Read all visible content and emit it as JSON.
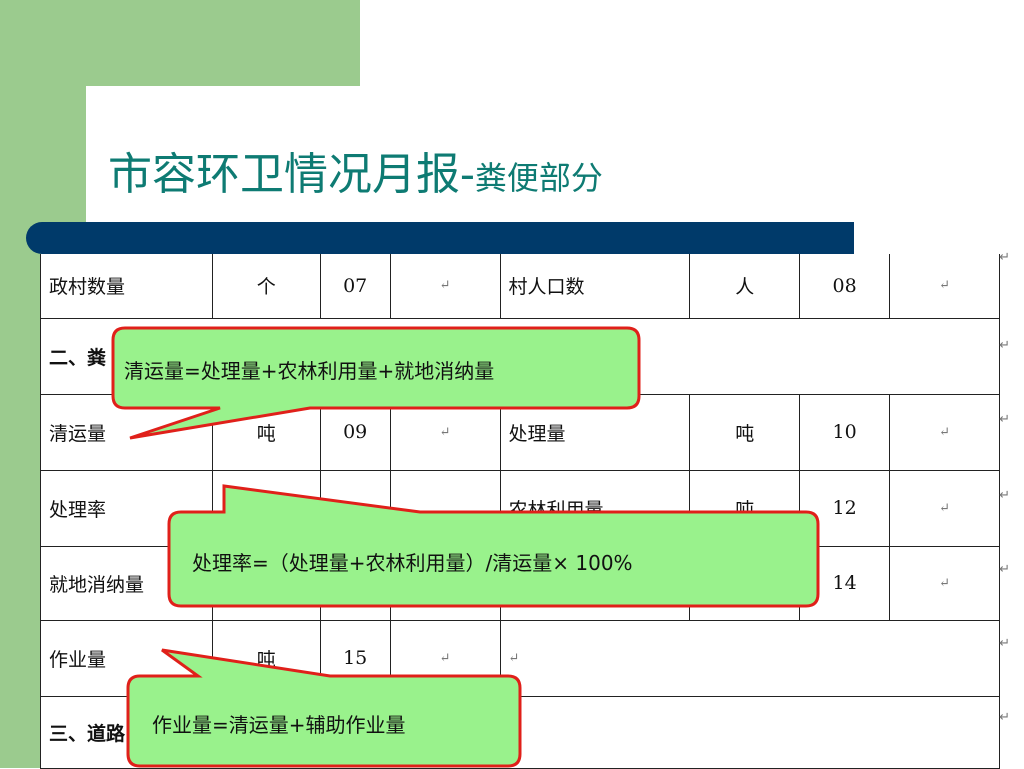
{
  "slide": {
    "title_main": "市容环卫情况月报-",
    "title_sub": "粪便部分",
    "colors": {
      "band_green": "#9bcb8e",
      "title_teal": "#0e7b73",
      "bar_navy": "#003a6a",
      "callout_fill": "#99f28c",
      "callout_border": "#e0201a"
    }
  },
  "table": {
    "row1": {
      "label": "政村数量",
      "unit": "个",
      "code": "07",
      "label2": "村人口数",
      "unit2": "人",
      "code2": "08"
    },
    "row2": {
      "section": "二、粪"
    },
    "row3": {
      "label": "清运量",
      "unit": "吨",
      "code": "09",
      "label2": "处理量",
      "unit2": "吨",
      "code2": "10"
    },
    "row4": {
      "label": "处理率",
      "label2": "农林利用量",
      "unit2": "吨",
      "code2": "12"
    },
    "row5": {
      "label": "就地消纳量",
      "code2": "14"
    },
    "row6": {
      "label": "作业量",
      "unit": "吨",
      "code": "15"
    },
    "row7": {
      "section": "三、道路"
    },
    "return_mark": "↵"
  },
  "callouts": {
    "c1": "清运量=处理量+农林利用量+就地消纳量",
    "c2": "处理率=（处理量+农林利用量）/清运量× 100%",
    "c3": "作业量=清运量+辅助作业量"
  }
}
